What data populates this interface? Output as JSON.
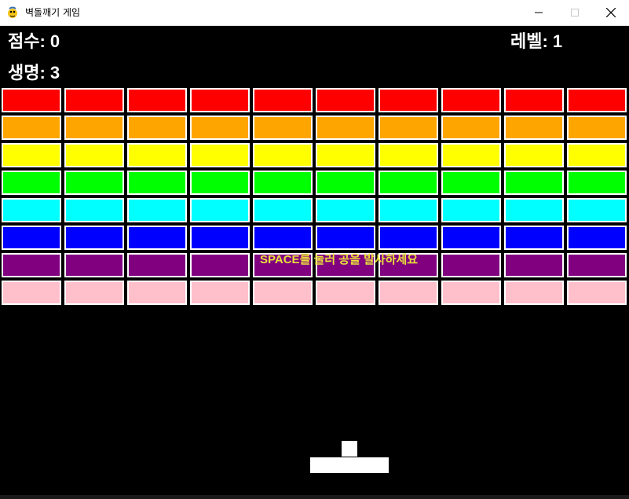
{
  "window": {
    "title": "벽돌깨기 게임",
    "icon": "python-snake-icon"
  },
  "hud": {
    "score_text": "점수: 0",
    "level_text": "레벨: 1",
    "lives_text": "생명: 3"
  },
  "hint": {
    "text": "SPACE를 눌러 공을 발사하세요",
    "color": "#e8e03a"
  },
  "bricks": {
    "columns": 10,
    "rows": [
      {
        "color": "#ff0000"
      },
      {
        "color": "#ffa500"
      },
      {
        "color": "#ffff00"
      },
      {
        "color": "#00ff00"
      },
      {
        "color": "#00ffff"
      },
      {
        "color": "#0000ff"
      },
      {
        "color": "#800080"
      },
      {
        "color": "#ffc0cb"
      }
    ]
  },
  "colors": {
    "background": "#000000",
    "brick_border": "#ffffff",
    "paddle": "#ffffff",
    "ball": "#ffffff"
  }
}
